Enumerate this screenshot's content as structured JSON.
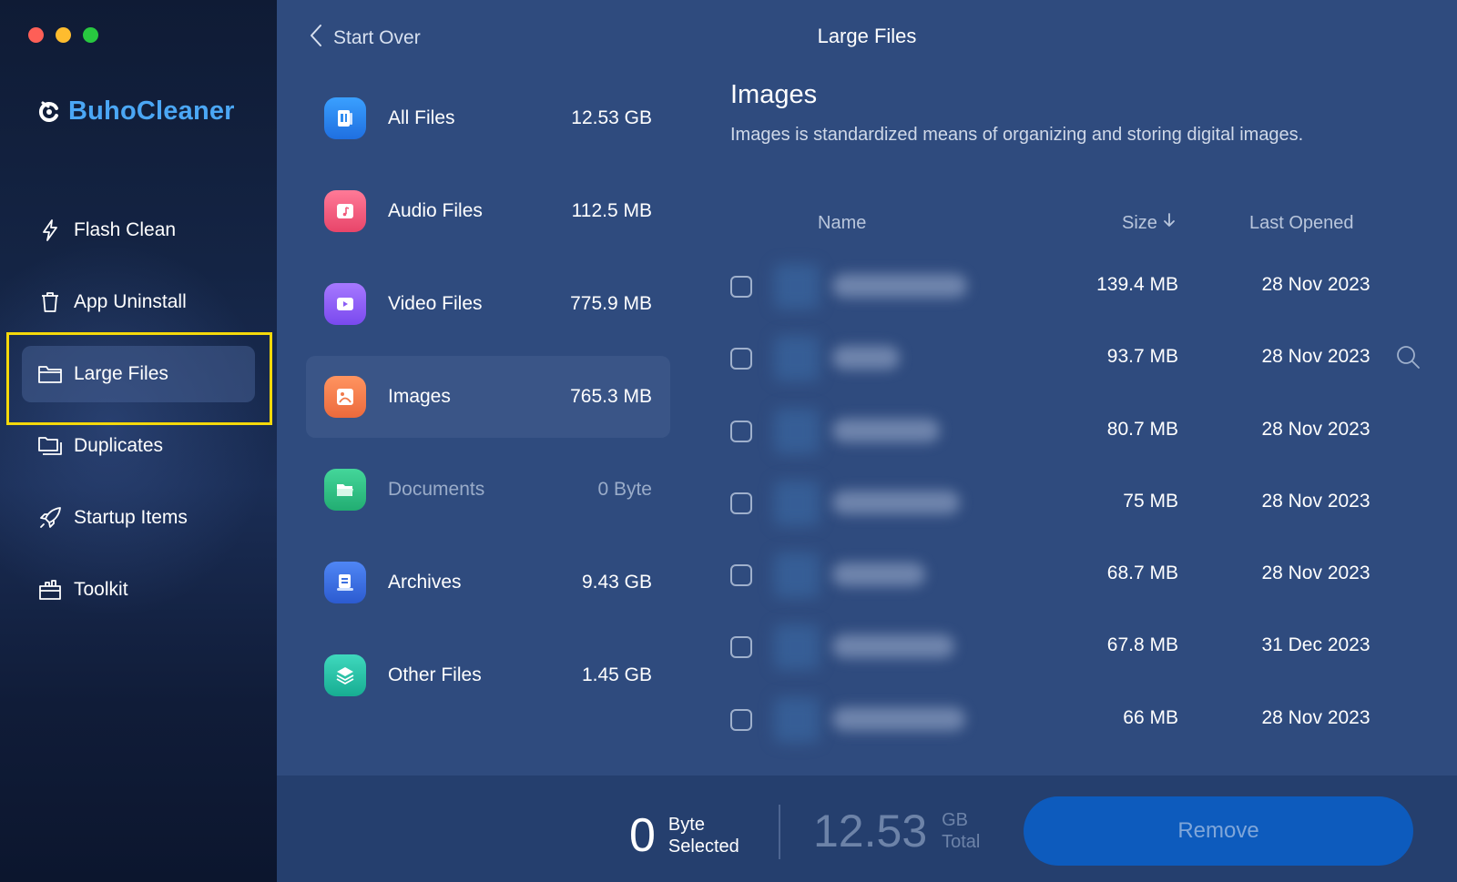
{
  "window": {
    "traffic_lights": [
      "close",
      "minimize",
      "zoom"
    ]
  },
  "sidebar": {
    "brand": "BuhoCleaner",
    "brand_color": "#4ba7f5",
    "items": [
      {
        "label": "Flash Clean",
        "icon": "bolt-icon"
      },
      {
        "label": "App Uninstall",
        "icon": "trash-icon"
      },
      {
        "label": "Large Files",
        "icon": "folder-icon",
        "active": true
      },
      {
        "label": "Duplicates",
        "icon": "duplicate-folder-icon"
      },
      {
        "label": "Startup Items",
        "icon": "rocket-icon"
      },
      {
        "label": "Toolkit",
        "icon": "toolbox-icon"
      }
    ]
  },
  "header": {
    "back_label": "Start Over",
    "title": "Large Files"
  },
  "categories": [
    {
      "label": "All Files",
      "size": "12.53 GB",
      "icon": "document-icon",
      "color": "#2f8cf0"
    },
    {
      "label": "Audio Files",
      "size": "112.5 MB",
      "icon": "music-icon",
      "color": "#f0597a"
    },
    {
      "label": "Video Files",
      "size": "775.9 MB",
      "icon": "play-icon",
      "color": "#8a5cf5"
    },
    {
      "label": "Images",
      "size": "765.3 MB",
      "icon": "image-icon",
      "color": "#f07a4a",
      "active": true
    },
    {
      "label": "Documents",
      "size": "0 Byte",
      "icon": "open-folder-icon",
      "color": "#2ec283",
      "disabled": true
    },
    {
      "label": "Archives",
      "size": "9.43 GB",
      "icon": "archive-icon",
      "color": "#3b6fe0"
    },
    {
      "label": "Other Files",
      "size": "1.45 GB",
      "icon": "layers-icon",
      "color": "#23c2a6"
    }
  ],
  "details": {
    "title": "Images",
    "description": "Images is standardized means of organizing and storing digital images."
  },
  "table": {
    "columns": {
      "name": "Name",
      "size": "Size",
      "last_opened": "Last Opened"
    },
    "sort": "size-desc",
    "rows": [
      {
        "size": "139.4 MB",
        "last_opened": "28 Nov 2023"
      },
      {
        "size": "93.7 MB",
        "last_opened": "28 Nov 2023"
      },
      {
        "size": "80.7 MB",
        "last_opened": "28 Nov 2023"
      },
      {
        "size": "75 MB",
        "last_opened": "28 Nov 2023"
      },
      {
        "size": "68.7 MB",
        "last_opened": "28 Nov 2023"
      },
      {
        "size": "67.8 MB",
        "last_opened": "31 Dec 2023"
      },
      {
        "size": "66 MB",
        "last_opened": "28 Nov 2023"
      }
    ]
  },
  "footer": {
    "selected_value": "0",
    "selected_unit": "Byte",
    "selected_label": "Selected",
    "total_value": "12.53",
    "total_unit": "GB",
    "total_label": "Total",
    "remove_label": "Remove"
  }
}
